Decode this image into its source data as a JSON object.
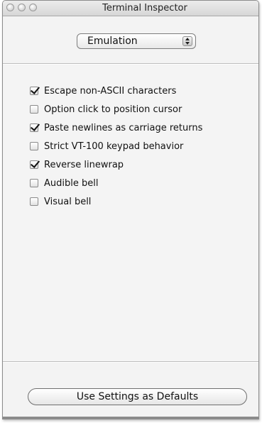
{
  "window": {
    "title": "Terminal Inspector"
  },
  "popup": {
    "selected": "Emulation"
  },
  "options": [
    {
      "label": "Escape non-ASCII characters",
      "checked": true
    },
    {
      "label": "Option click to position cursor",
      "checked": false
    },
    {
      "label": "Paste newlines as carriage returns",
      "checked": true
    },
    {
      "label": "Strict VT-100 keypad behavior",
      "checked": false
    },
    {
      "label": "Reverse linewrap",
      "checked": true
    },
    {
      "label": "Audible bell",
      "checked": false
    },
    {
      "label": "Visual bell",
      "checked": false
    }
  ],
  "footer": {
    "defaults_button": "Use Settings as Defaults"
  },
  "icons": {
    "close": "close-button",
    "minimize": "minimize-button",
    "zoom": "zoom-button",
    "popup_arrows": "up-down-arrows-icon",
    "checkmark": "checkmark-icon"
  }
}
